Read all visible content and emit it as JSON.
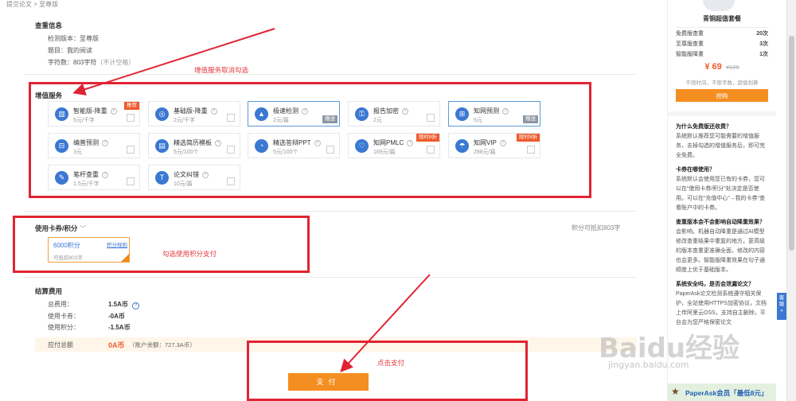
{
  "breadcrumb": {
    "item1": "提交论文",
    "sep": ">",
    "item2": "至尊版"
  },
  "check_info": {
    "title": "查重信息",
    "version_label": "检测版本：至尊版",
    "topic_label": "题目：我的阅读",
    "chars_label": "字符数：803字符",
    "chars_note": "（不计空格）"
  },
  "annotations": {
    "service_note": "增值服务取消勾选",
    "points_note": "勾选使用积分支付",
    "pay_note": "点击支付"
  },
  "value_added": {
    "title": "增值服务",
    "services": [
      {
        "name": "智能版-降重",
        "price": "5元/千字",
        "tag": "推荐"
      },
      {
        "name": "基础版-降重",
        "price": "2元/千字"
      },
      {
        "name": "极速检测",
        "price": "2元/篇",
        "gift": "赠送"
      },
      {
        "name": "报告加密",
        "price": "2元"
      },
      {
        "name": "知网预测",
        "price": "5元",
        "gift": "赠送"
      },
      {
        "name": "编普预测",
        "price": "3元"
      },
      {
        "name": "精选简历模板",
        "price": "5元/100个"
      },
      {
        "name": "精选答辩PPT",
        "price": "5元/100个"
      },
      {
        "name": "知网PMLC",
        "price": "169元/篇",
        "tag": "限时8折"
      },
      {
        "name": "知网VIP",
        "price": "288元/篇",
        "tag": "限时8折"
      },
      {
        "name": "笔杆查重",
        "price": "1.5元/千字"
      },
      {
        "name": "论文纠错",
        "price": "10元/篇"
      }
    ]
  },
  "coupon_section": {
    "title": "使用卡券/积分",
    "right_text": "积分可抵扣803字",
    "coupon": {
      "value": "6000积分",
      "deduct": "可抵扣803字",
      "rule": "积分规则"
    }
  },
  "settlement": {
    "title": "结算费用",
    "rows": [
      {
        "label": "总费用：",
        "value": "1.5A币"
      },
      {
        "label": "使用卡券：",
        "value": "-0A币"
      },
      {
        "label": "使用积分：",
        "value": "-1.5A币"
      }
    ],
    "due_label": "应付总额",
    "due_value": "0A币",
    "balance": "（账户余额：727.3A币）",
    "pay_button": "支付"
  },
  "sidebar": {
    "package": {
      "title": "青铜超值套餐",
      "items": [
        {
          "name": "免费版查重",
          "count": "20次"
        },
        {
          "name": "至尊版查重",
          "count": "3次"
        },
        {
          "name": "智能版降重",
          "count": "1次"
        }
      ],
      "price": "¥ 69",
      "old_price": "¥120",
      "note": "不限时间，不限字数，超值划算",
      "buy_button": "抢购"
    },
    "faq": [
      {
        "q": "为什么免费版还收费？",
        "a": "系统默认推荐您可能需要的增值服务，去掉勾选的增值服务后，即可完全免费。"
      },
      {
        "q": "卡券在哪使用？",
        "a": "系统默认会使用您已有的卡券，您可以在“使用卡券/积分”处决定是否使用。可以在“充值中心”→我的卡券“查看账户中的卡券。"
      },
      {
        "q": "查重版本会不会影响自动降重效果？",
        "a": "会影响。机器自动降重是通过AI模型修改查重结果中重复的地方，更高级的版本查重更准确全面，修改的内容也会更多。智能版降重效果在句子通顺度上优于基础版本。"
      },
      {
        "q": "系统安全吗，是否会泄漏论文？",
        "a": "PaperAsk论文检测系统遵守相关保护，全站使用HTTPS加密协议，文档上传阿里云OSS，支持自主删除，平台会为您严格保密论文"
      }
    ],
    "float_tab": "客服",
    "banner": "PaperAsk会员「最低8元」"
  },
  "watermark": {
    "brand": "Baidu经验",
    "url": "jingyan.baidu.com"
  },
  "colors": {
    "accent_blue": "#3a78d2",
    "pay_orange": "#f58e20",
    "annotation_red": "#e02433",
    "tag_orange": "#ef5a2b"
  }
}
